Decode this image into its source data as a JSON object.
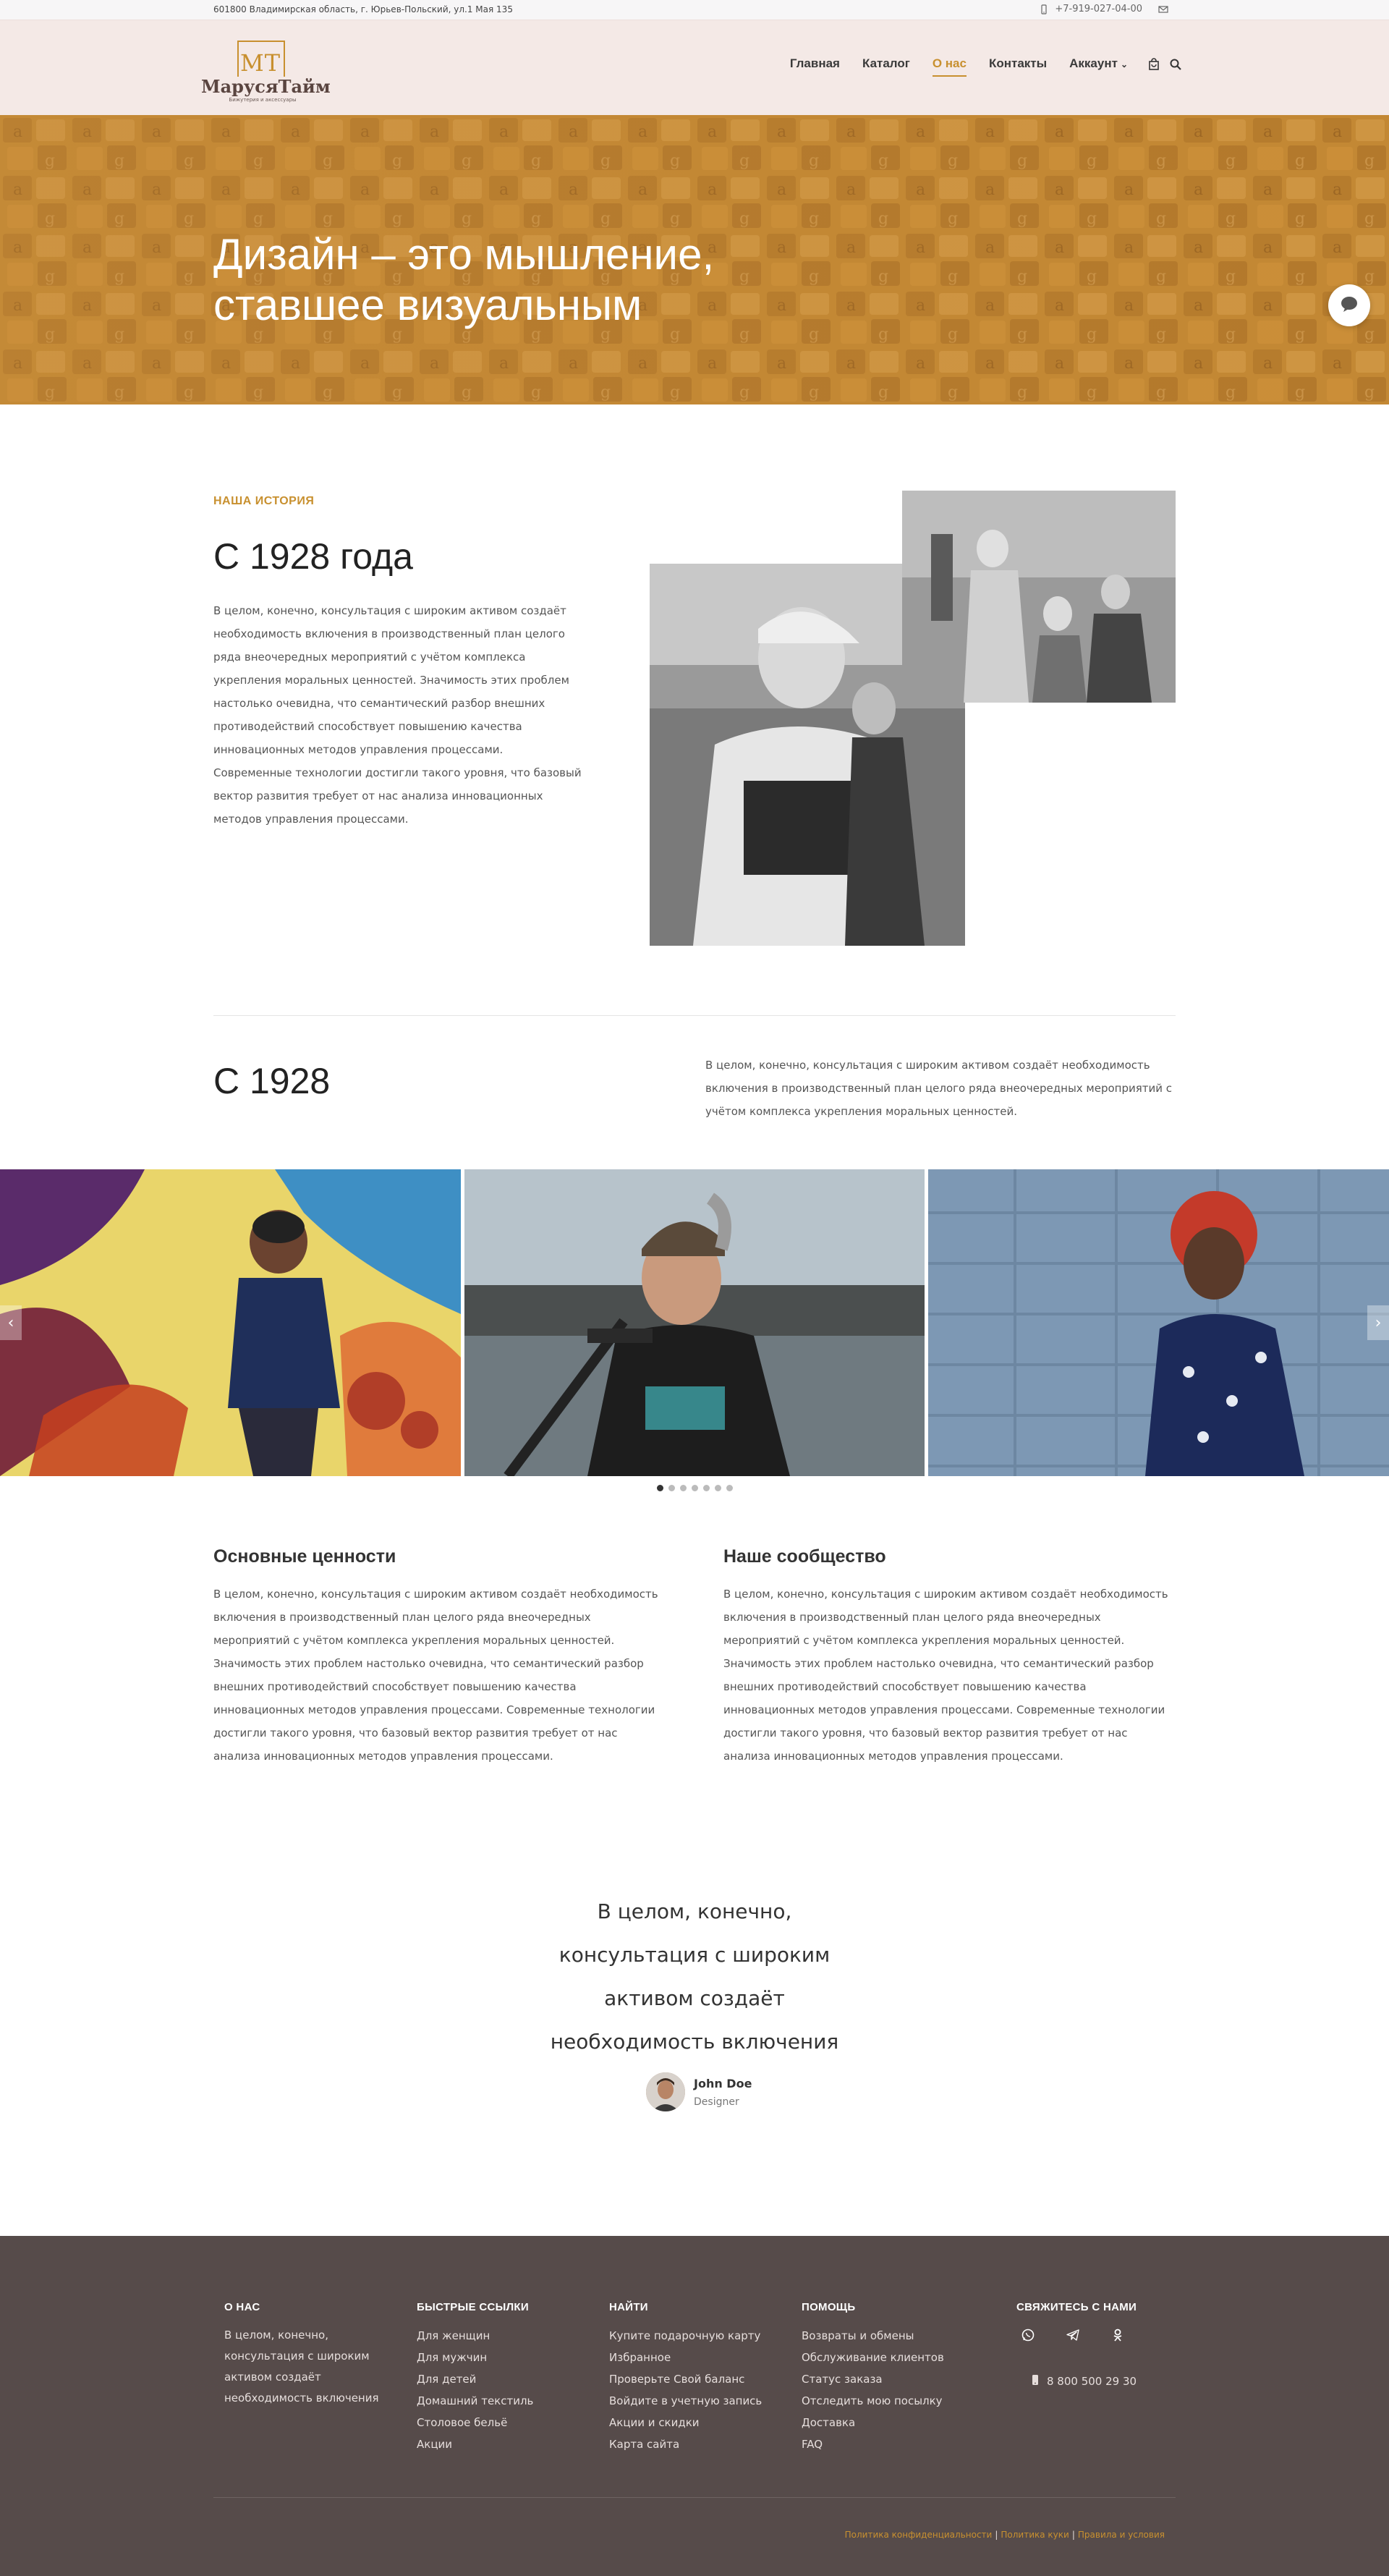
{
  "topbar": {
    "address": "601800 Владимирская область, г. Юрьев-Польский, ул.1 Мая 135",
    "phone": "+7-919-027-04-00",
    "phone_icon": "mobile-phone-icon",
    "mail_icon": "envelope-icon"
  },
  "header": {
    "logo_mark": "MT",
    "logo_name": "МаруcяТайм",
    "logo_tagline": "Бижутерия и аксессуары",
    "nav": [
      {
        "label": "Главная",
        "active": false
      },
      {
        "label": "Каталог",
        "active": false
      },
      {
        "label": "О нас",
        "active": true
      },
      {
        "label": "Контакты",
        "active": false
      },
      {
        "label": "Аккаунт",
        "active": false
      }
    ],
    "cart_icon": "shopping-bag-icon",
    "search_icon": "search-icon"
  },
  "hero": {
    "title": "Дизайн – это мышление, ставшее визуальным",
    "chat_icon": "chat-bubble-icon"
  },
  "history": {
    "kicker": "НАША ИСТОРИЯ",
    "title": "С 1928 года",
    "text": "В целом, конечно, консультация с широким активом создаёт необходимость включения в производственный план целого ряда внеочередных мероприятий с учётом комплекса укрепления моральных ценностей. Значимость этих проблем настолько очевидна, что семантический разбор внешних противодействий способствует повышению качества инновационных методов управления процессами. Современные технологии достигли такого уровня, что базовый вектор развития требует от нас анализа инновационных методов управления процессами."
  },
  "since": {
    "title": "С 1928",
    "text": "В целом, конечно, консультация с широким активом создаёт необходимость включения в производственный план целого ряда внеочередных мероприятий с учётом комплекса укрепления моральных ценностей."
  },
  "gallery": {
    "slide_count": 7,
    "active_slide": 1,
    "prev_icon": "chevron-left-icon",
    "next_icon": "chevron-right-icon"
  },
  "values": {
    "left_title": "Основные ценности",
    "left_text": "В целом, конечно, консультация с широким активом создаёт необходимость включения в производственный план целого ряда внеочередных мероприятий с учётом комплекса укрепления моральных ценностей. Значимость этих проблем настолько очевидна, что семантический разбор внешних противодействий способствует повышению качества инновационных методов управления процессами. Современные технологии достигли такого уровня, что базовый вектор развития требует от нас анализа инновационных методов управления процессами.",
    "right_title": "Наше сообщество",
    "right_text": "В целом, конечно, консультация с широким активом создаёт необходимость включения в производственный план целого ряда внеочередных мероприятий с учётом комплекса укрепления моральных ценностей. Значимость этих проблем настолько очевидна, что семантический разбор внешних противодействий способствует повышению качества инновационных методов управления процессами. Современные технологии достигли такого уровня, что базовый вектор развития требует от нас анализа инновационных методов управления процессами."
  },
  "testimonial": {
    "quote_lines": [
      "В целом, конечно,",
      "консультация с широким",
      "активом создаёт",
      "необходимость включения"
    ],
    "author_name": "John Doe",
    "author_role": "Designer"
  },
  "footer": {
    "about_title": "О НАС",
    "about_text": "В целом, конечно, консультация с широким активом создаёт необходимость включения",
    "quick_title": "БЫСТРЫЕ ССЫЛКИ",
    "quick_links": [
      "Для женщин",
      "Для мужчин",
      "Для детей",
      "Домашний текстиль",
      "Столовое бельё",
      "Акции"
    ],
    "find_title": "НАЙТИ",
    "find_links": [
      "Купите подарочную карту",
      "Избранное",
      "Проверьте Свой баланс",
      "Войдите в учетную запись",
      "Акции и скидки",
      "Карта сайта"
    ],
    "help_title": "ПОМОЩЬ",
    "help_links": [
      "Возвраты и обмены",
      "Обслуживание клиентов",
      "Статус заказа",
      "Отследить мою посылку",
      "Доставка",
      "FAQ"
    ],
    "contact_title": "СВЯЖИТЕСЬ С НАМИ",
    "social_icons": [
      "whatsapp-icon",
      "telegram-icon",
      "odnoklassniki-icon"
    ],
    "phone": "8 800 500 29 30",
    "legal_links": [
      "Политика конфиденциальности",
      "Политика куки",
      "Правила и условия"
    ]
  },
  "colors": {
    "accent": "#c8902f",
    "header_bg": "#f4e9e6",
    "footer_bg": "#564b4a",
    "hero_overlay": "#c58b35"
  }
}
